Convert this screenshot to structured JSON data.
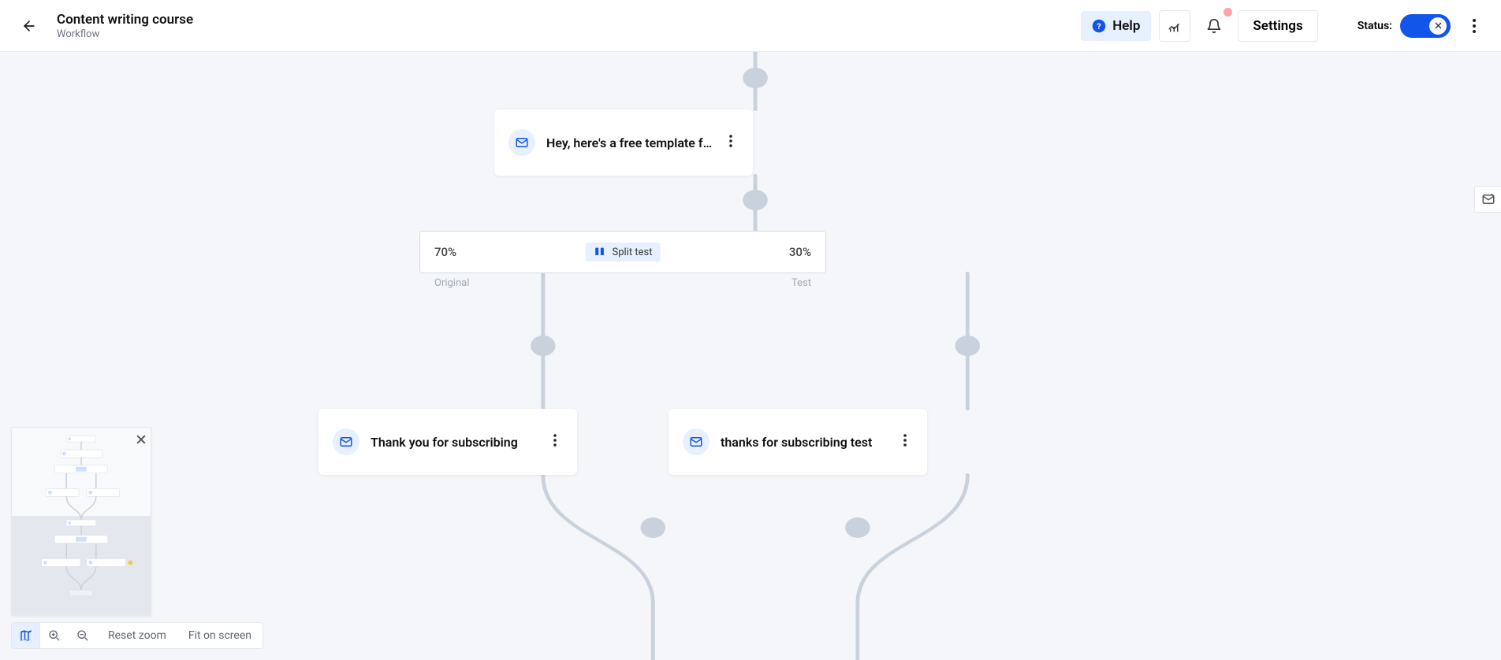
{
  "header": {
    "title": "Content writing course",
    "subtitle": "Workflow",
    "help_label": "Help",
    "settings_label": "Settings",
    "status_label": "Status:"
  },
  "nodes": {
    "email1": {
      "label": "Hey, here's a free template fo..."
    },
    "split": {
      "left_pct": "70%",
      "right_pct": "30%",
      "badge": "Split test",
      "original_label": "Original",
      "test_label": "Test"
    },
    "email_left": {
      "label": "Thank you for subscribing"
    },
    "email_right": {
      "label": "thanks for subscribing test"
    }
  },
  "zoom": {
    "reset": "Reset zoom",
    "fit": "Fit on screen"
  }
}
